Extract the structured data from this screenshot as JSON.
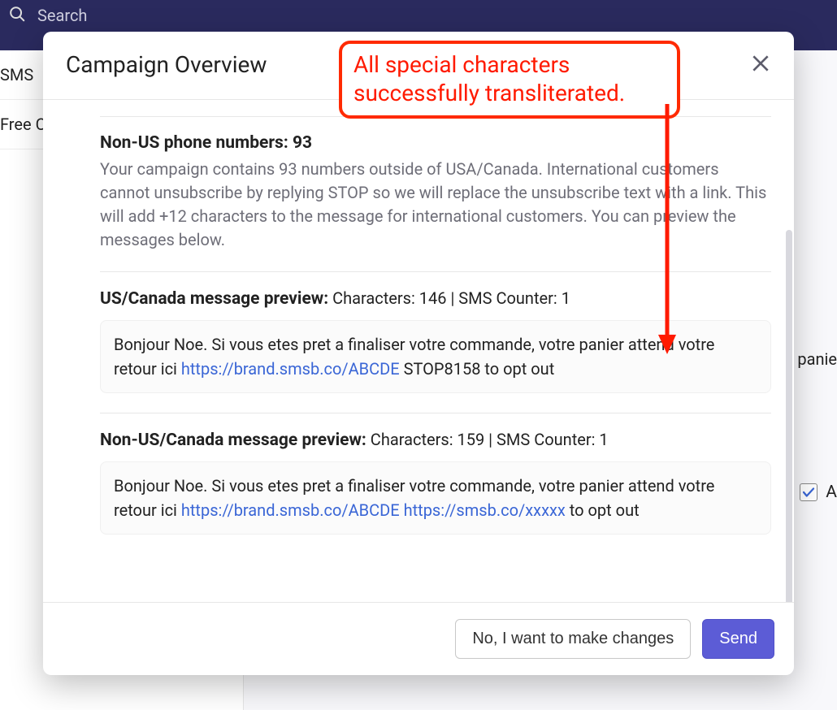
{
  "topbar": {
    "search_placeholder": "Search"
  },
  "sidebar": {
    "items": [
      "SMS",
      "Free C"
    ]
  },
  "background": {
    "panie_text": "e panie",
    "checkbox_label": "A"
  },
  "modal": {
    "title": "Campaign Overview",
    "non_us_header": "Non-US phone numbers: 93",
    "non_us_desc": "Your campaign contains 93 numbers outside of USA/Canada. International customers cannot unsubscribe by replying STOP so we will replace the unsubscribe text with a link. This will add +12 characters to the message for international customers. You can preview the messages below.",
    "us_preview_label": "US/Canada message preview:",
    "us_preview_meta": " Characters: 146 | SMS Counter: 1",
    "us_preview_text_1": "Bonjour Noe. Si vous etes pret a finaliser votre commande, votre panier attend votre retour ici ",
    "us_preview_link": "https://brand.smsb.co/ABCDE",
    "us_preview_text_2": " STOP8158 to opt out",
    "nonus_preview_label": "Non-US/Canada message preview:",
    "nonus_preview_meta": " Characters: 159 | SMS Counter: 1",
    "nonus_preview_text_1": "Bonjour Noe. Si vous etes pret a finaliser votre commande, votre panier attend votre retour ici ",
    "nonus_preview_link1": "https://brand.smsb.co/ABCDE",
    "nonus_preview_gap": " ",
    "nonus_preview_link2": "https://smsb.co/xxxxx",
    "nonus_preview_text_2": " to opt out",
    "cancel_label": "No, I want to make changes",
    "send_label": "Send"
  },
  "annotation": {
    "text": "All special characters successfully transliterated."
  }
}
